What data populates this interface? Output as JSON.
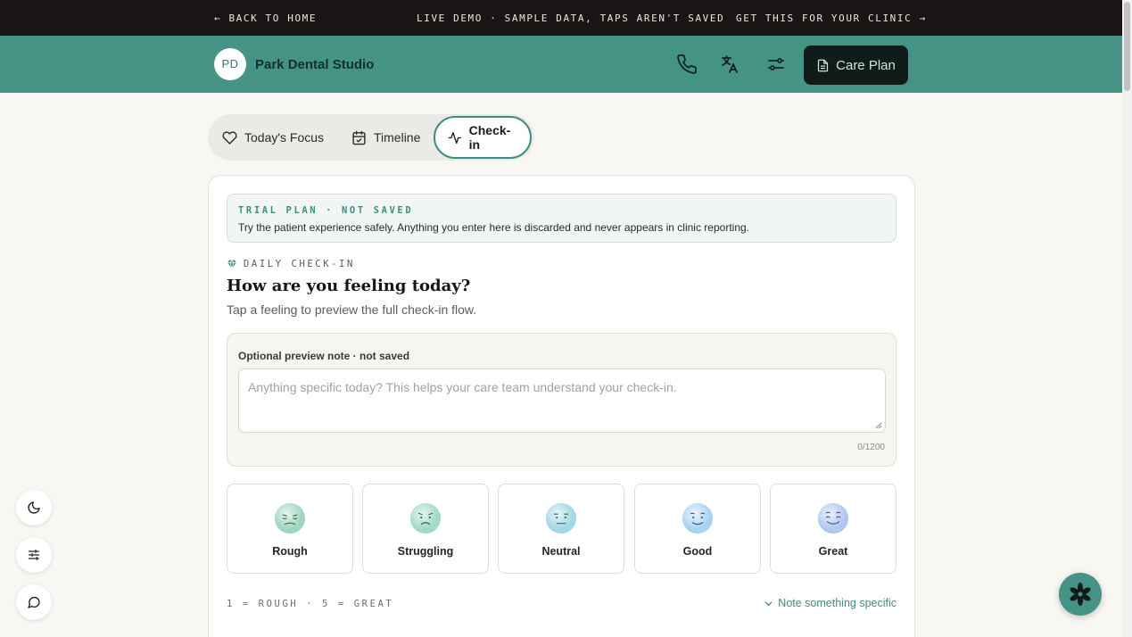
{
  "topbar": {
    "back_link": "← BACK TO HOME",
    "demo_notice": "LIVE DEMO · SAMPLE DATA, TAPS AREN'T SAVED",
    "cta_link": "GET THIS FOR YOUR CLINIC →"
  },
  "header": {
    "avatar_initials": "PD",
    "clinic_name": "Park Dental Studio",
    "care_plan_label": "Care Plan",
    "icons": [
      "phone-icon",
      "translate-icon",
      "settings-sliders-icon",
      "document-icon"
    ],
    "accent": "#449385"
  },
  "tabs": [
    {
      "label": "Today's Focus",
      "icon": "heart-icon",
      "active": false
    },
    {
      "label": "Timeline",
      "icon": "calendar-check-icon",
      "active": false
    },
    {
      "label": "Check-in",
      "icon": "activity-icon",
      "active": true
    }
  ],
  "trial_banner": {
    "kicker": "TRIAL PLAN · NOT SAVED",
    "message": "Try the patient experience safely. Anything you enter here is discarded and never appears in clinic reporting."
  },
  "checkin": {
    "kicker": "DAILY CHECK-IN",
    "question": "How are you feeling today?",
    "subtitle": "Tap a feeling to preview the full check-in flow.",
    "note_label": "Optional preview note · not saved",
    "note_placeholder": "Anything specific today? This helps your care team understand your check-in.",
    "note_value": "",
    "char_count": "0/1200",
    "moods": [
      {
        "label": "Rough",
        "icon": "face-rough-icon"
      },
      {
        "label": "Struggling",
        "icon": "face-struggling-icon"
      },
      {
        "label": "Neutral",
        "icon": "face-neutral-icon"
      },
      {
        "label": "Good",
        "icon": "face-good-icon"
      },
      {
        "label": "Great",
        "icon": "face-great-icon"
      }
    ],
    "scale_hint": "1 = ROUGH · 5 = GREAT",
    "note_toggle": "Note something specific"
  },
  "floating_controls": [
    "moon-icon",
    "sliders-icon",
    "chat-icon"
  ],
  "assistant_button_icon": "flower-icon"
}
